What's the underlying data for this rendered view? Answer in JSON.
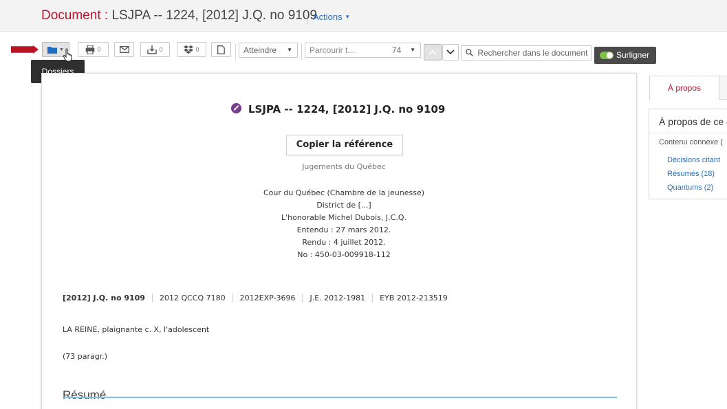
{
  "header": {
    "title_label": "Document :",
    "title_name": "LSJPA -- 1224, [2012] J.Q. no 9109",
    "actions_label": "Actions"
  },
  "toolbar": {
    "print_badge": "0",
    "download_badge": "0",
    "dropbox_badge": "0",
    "atteindre_label": "Atteindre",
    "parcourir_placeholder": "Parcourir t...",
    "parcourir_value": "74",
    "search_placeholder": "Rechercher dans le document",
    "highlight_label": "Surligner"
  },
  "tooltip": {
    "text": "Dossiers"
  },
  "document": {
    "heading": "LSJPA -- 1224, [2012] J.Q. no 9109",
    "copy_button": "Copier la référence",
    "source": "Jugements du Québec",
    "court": "Cour du Québec (Chambre de la jeunesse)",
    "district": "District de [...]",
    "judge": "L'honorable Michel Dubois, J.C.Q.",
    "heard": "Entendu : 27 mars 2012.",
    "rendered": "Rendu : 4 juillet 2012.",
    "number": "No : 450-03-009918-112",
    "citations": [
      "[2012] J.Q. no 9109",
      "2012 QCCQ 7180",
      "2012EXP-3696",
      "J.E. 2012-1981",
      "EYB 2012-213519"
    ],
    "parties": "LA REINE, plaignante c. X, l'adolescent",
    "paragraphs": "(73 paragr.)",
    "section_title": "Résumé"
  },
  "sidebar": {
    "tab_label": "À propos",
    "box_title": "À propos de ce d",
    "related_label": "Contenu connexe (",
    "links": [
      "Décisions citant",
      "Résumés (18)",
      "Quantums (2)"
    ]
  }
}
